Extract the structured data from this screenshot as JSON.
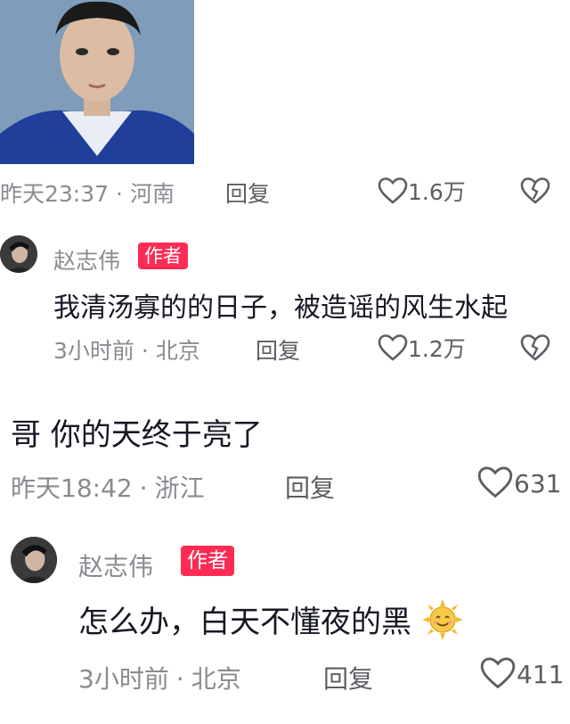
{
  "comments": [
    {
      "time": "昨天23:37",
      "location": "河南",
      "reply_label": "回复",
      "likes": "1.6万"
    },
    {
      "author": "赵志伟",
      "badge": "作者",
      "text": "我清汤寡的的日子，被造谣的风生水起",
      "time": "3小时前",
      "location": "北京",
      "reply_label": "回复",
      "likes": "1.2万"
    },
    {
      "text": "哥 你的天终于亮了",
      "time": "昨天18:42",
      "location": "浙江",
      "reply_label": "回复",
      "likes": "631"
    },
    {
      "author": "赵志伟",
      "badge": "作者",
      "text": "怎么办，白天不懂夜的黑",
      "time": "3小时前",
      "location": "北京",
      "reply_label": "回复",
      "likes": "411"
    }
  ],
  "separator": "·",
  "icons": {
    "like": "heart-outline-icon",
    "dislike": "broken-heart-icon",
    "emoji": "sun-emoji-icon"
  },
  "colors": {
    "badge": "#fe2c55",
    "meta_text": "#8a8b91",
    "main_text": "#161823"
  }
}
